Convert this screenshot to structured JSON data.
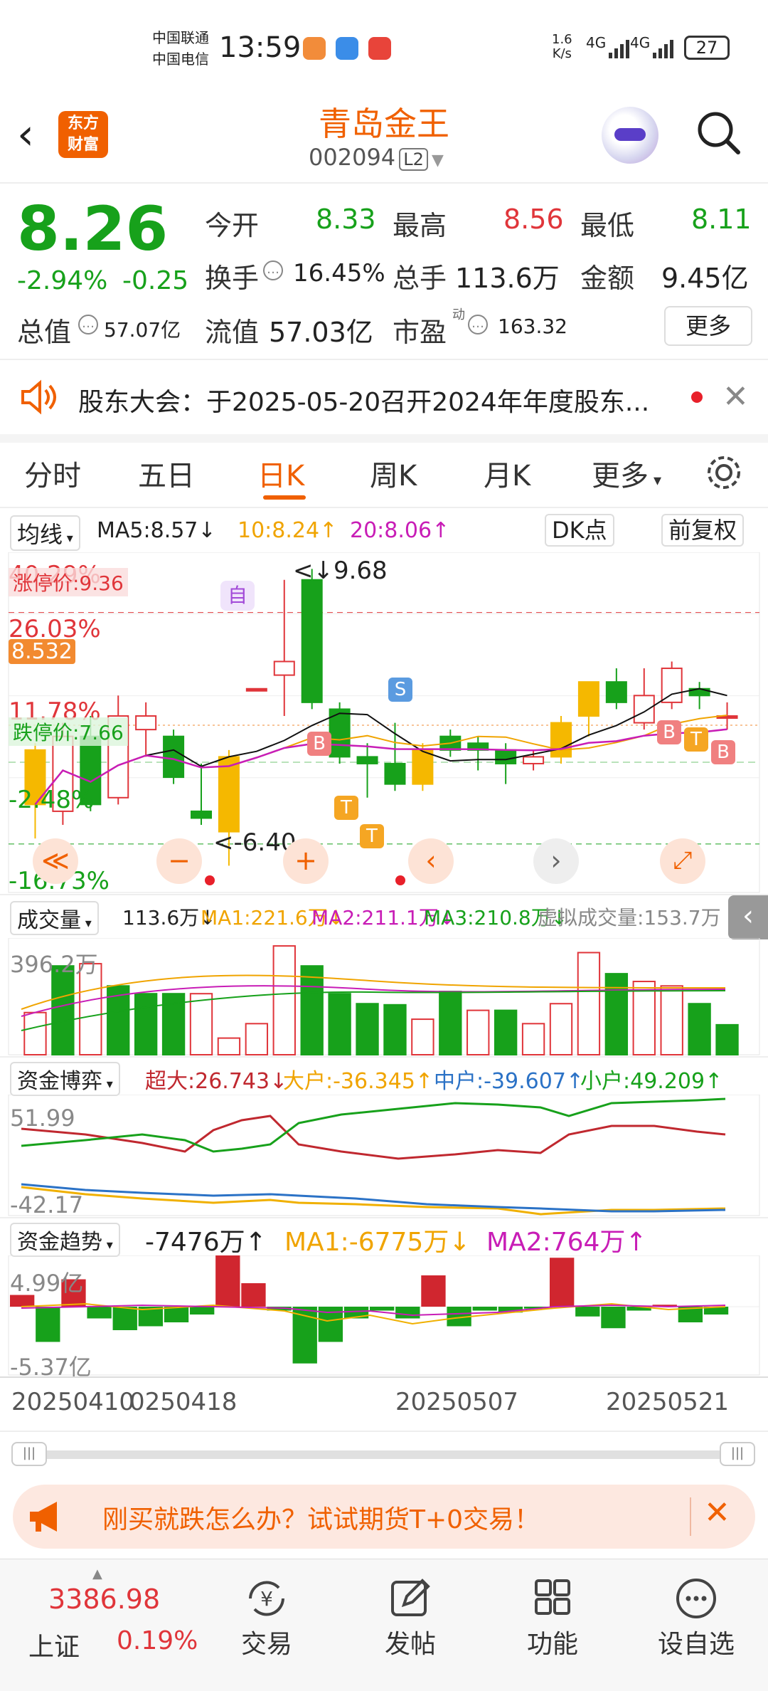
{
  "status_bar": {
    "carrier1": "中国联通",
    "carrier2": "中国电信",
    "time": "13:59",
    "speed_top": "1.6",
    "speed_bottom": "K/s",
    "net1": "4G",
    "net2": "4G",
    "battery": "27"
  },
  "header": {
    "logo_line1": "东方",
    "logo_line2": "财富",
    "title": "青岛金王",
    "code": "002094",
    "level": "L2"
  },
  "quote": {
    "price": "8.26",
    "change_pct": "-2.94%",
    "change": "-0.25",
    "open_label": "今开",
    "open": "8.33",
    "high_label": "最高",
    "high": "8.56",
    "low_label": "最低",
    "low": "8.11",
    "turnover_label": "换手",
    "turnover": "16.45%",
    "volume_label": "总手",
    "volume": "113.6万",
    "amount_label": "金额",
    "amount": "9.45亿",
    "mktcap_label": "总值",
    "mktcap": "57.07亿",
    "float_label": "流值",
    "float_cap": "57.03亿",
    "pe_label": "市盈",
    "pe_sup": "动",
    "pe": "163.32",
    "more": "更多"
  },
  "notice": {
    "text": "股东大会：于2025-05-20召开2024年年度股东..."
  },
  "tabs": [
    "分时",
    "五日",
    "日K",
    "周K",
    "月K",
    "更多"
  ],
  "active_tab": 2,
  "ma_bar": {
    "selector": "均线",
    "ma5": "MA5:8.57",
    "ma10": "10:8.24",
    "ma20": "20:8.06",
    "dk": "DK点",
    "adjust": "前复权"
  },
  "kline": {
    "pct_labels": [
      "40.29%",
      "26.03%",
      "11.78%",
      "-2.48%",
      "-16.73%"
    ],
    "limit_up": "涨停价:9.36",
    "limit_down": "跌停价:7.66",
    "price_tag": "8.532",
    "max_label": "9.68",
    "min_label": "-6.40",
    "marker_self": "自",
    "markers": [
      "B",
      "T",
      "T",
      "S",
      "B",
      "T",
      "B"
    ]
  },
  "chart_data": {
    "type": "candlestick",
    "dates_shown": [
      "20250410",
      "20250418",
      "20250507",
      "20250521"
    ],
    "candles": [
      {
        "o": 8.35,
        "c": 7.95,
        "h": 8.4,
        "l": 7.7
      },
      {
        "o": 7.9,
        "c": 8.45,
        "h": 8.55,
        "l": 7.8
      },
      {
        "o": 8.45,
        "c": 7.95,
        "h": 8.6,
        "l": 7.9
      },
      {
        "o": 8.0,
        "c": 8.6,
        "h": 8.75,
        "l": 7.95
      },
      {
        "o": 8.5,
        "c": 8.6,
        "h": 8.7,
        "l": 8.3
      },
      {
        "o": 8.45,
        "c": 8.15,
        "h": 8.5,
        "l": 8.1
      },
      {
        "o": 7.9,
        "c": 7.85,
        "h": 8.25,
        "l": 7.8
      },
      {
        "o": 7.75,
        "c": 8.3,
        "h": 8.35,
        "l": 7.5
      },
      {
        "o": 8.8,
        "c": 8.8,
        "h": 8.8,
        "l": 8.8
      },
      {
        "o": 8.9,
        "c": 9.0,
        "h": 9.6,
        "l": 8.6
      },
      {
        "o": 9.6,
        "c": 8.7,
        "h": 9.68,
        "l": 8.65
      },
      {
        "o": 8.65,
        "c": 8.3,
        "h": 8.7,
        "l": 8.25
      },
      {
        "o": 8.3,
        "c": 8.25,
        "h": 8.4,
        "l": 8.0
      },
      {
        "o": 8.25,
        "c": 8.1,
        "h": 8.55,
        "l": 8.05
      },
      {
        "o": 8.1,
        "c": 8.35,
        "h": 8.4,
        "l": 8.05
      },
      {
        "o": 8.45,
        "c": 8.35,
        "h": 8.5,
        "l": 8.3
      },
      {
        "o": 8.4,
        "c": 8.35,
        "h": 8.45,
        "l": 8.2
      },
      {
        "o": 8.35,
        "c": 8.25,
        "h": 8.4,
        "l": 8.1
      },
      {
        "o": 8.25,
        "c": 8.3,
        "h": 8.35,
        "l": 8.2
      },
      {
        "o": 8.3,
        "c": 8.55,
        "h": 8.6,
        "l": 8.25
      },
      {
        "o": 8.6,
        "c": 8.85,
        "h": 8.85,
        "l": 8.45
      },
      {
        "o": 8.85,
        "c": 8.7,
        "h": 8.95,
        "l": 8.65
      },
      {
        "o": 8.55,
        "c": 8.75,
        "h": 8.95,
        "l": 8.5
      },
      {
        "o": 8.7,
        "c": 8.95,
        "h": 9.0,
        "l": 8.65
      },
      {
        "o": 8.8,
        "c": 8.75,
        "h": 8.85,
        "l": 8.65
      },
      {
        "o": 8.6,
        "c": 8.6,
        "h": 8.7,
        "l": 8.5
      }
    ]
  },
  "zoom_buttons": [
    "≪",
    "−",
    "+",
    "‹",
    "›",
    "⤢"
  ],
  "volume": {
    "selector": "成交量",
    "current": "113.6万",
    "ma1": "MA1:221.6万",
    "ma2": "MA2:211.1万",
    "ma3": "MA3:210.8万",
    "virtual": "虚拟成交量:153.7万",
    "max_label": "396.2万"
  },
  "capital_game": {
    "selector": "资金博弈",
    "super": "超大:26.743",
    "large": "大户:-36.345",
    "mid": "中户:-39.607",
    "small": "小户:49.209",
    "top_label": "51.99",
    "bottom_label": "-42.17"
  },
  "capital_trend": {
    "selector": "资金趋势",
    "value": "-7476万",
    "ma1": "MA1:-6775万",
    "ma2": "MA2:764万",
    "top_label": "4.99亿",
    "bottom_label": "-5.37亿"
  },
  "dates": [
    "20250410",
    "0250418",
    "20250507",
    "20250521"
  ],
  "ad": {
    "text": "刚买就跌怎么办？试试期货T+0交易！"
  },
  "bottom_nav": {
    "index_value": "3386.98",
    "index_name": "上证",
    "index_change": "0.19%",
    "items": [
      "交易",
      "发帖",
      "功能",
      "设自选"
    ]
  },
  "colors": {
    "up": "#e0353a",
    "down": "#17a11b",
    "brand": "#f06000",
    "ma10": "#f0a400",
    "ma20": "#c81db6"
  }
}
